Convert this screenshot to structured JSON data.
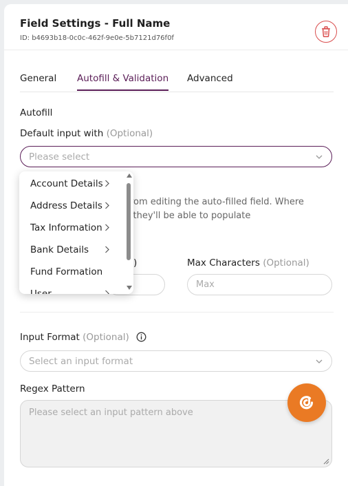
{
  "header": {
    "title": "Field Settings - Full Name",
    "id_text": "ID: b4693b18-0c0c-462f-9e0e-5b7121d76f0f"
  },
  "tabs": [
    {
      "label": "General",
      "active": false
    },
    {
      "label": "Autofill & Validation",
      "active": true
    },
    {
      "label": "Advanced",
      "active": false
    }
  ],
  "autofill": {
    "section_title": "Autofill",
    "default_label": "Default input with",
    "default_optional": "(Optional)",
    "default_placeholder": "Please select",
    "helper_line1": "rom editing the auto-filled field. Where",
    "helper_line2": "d, they'll be able to populate"
  },
  "dropdown": {
    "items": [
      {
        "label": "Account Details",
        "submenu": true
      },
      {
        "label": "Address Details",
        "submenu": true
      },
      {
        "label": "Tax Information",
        "submenu": true
      },
      {
        "label": "Bank Details",
        "submenu": true
      },
      {
        "label": "Fund Formation",
        "submenu": false
      },
      {
        "label": "User",
        "submenu": true
      }
    ]
  },
  "characters": {
    "min_label_fragment": ")",
    "max_label": "Max Characters",
    "max_optional": "(Optional)",
    "max_placeholder": "Max"
  },
  "input_format": {
    "label": "Input Format",
    "optional": "(Optional)",
    "placeholder": "Select an input format"
  },
  "regex": {
    "label": "Regex Pattern",
    "placeholder": "Please select an input pattern above"
  },
  "colors": {
    "accent": "#5a1d57",
    "danger": "#d94c4c",
    "fab": "#ea7a24"
  }
}
